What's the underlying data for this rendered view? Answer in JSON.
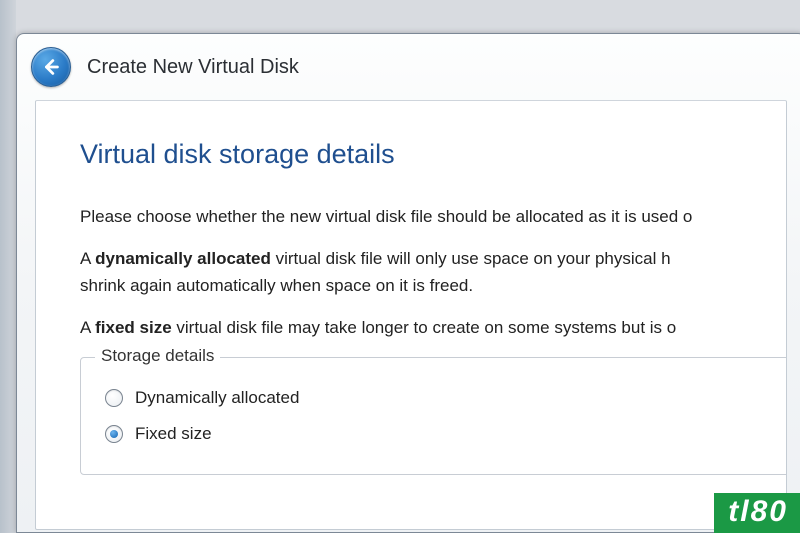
{
  "window": {
    "title": "Create New Virtual Disk"
  },
  "page": {
    "heading": "Virtual disk storage details",
    "intro": "Please choose whether the new virtual disk file should be allocated as it is used o",
    "dynamic_prefix": "A ",
    "dynamic_strong": "dynamically allocated",
    "dynamic_rest": " virtual disk file will only use space on your physical h",
    "dynamic_line2": "shrink again automatically when space on it is freed.",
    "fixed_prefix": "A ",
    "fixed_strong": "fixed size",
    "fixed_rest": " virtual disk file may take longer to create on some systems but is o"
  },
  "group": {
    "legend": "Storage details",
    "options": [
      {
        "label": "Dynamically allocated",
        "checked": false
      },
      {
        "label": "Fixed size",
        "checked": true
      }
    ]
  },
  "watermark": "tl80"
}
